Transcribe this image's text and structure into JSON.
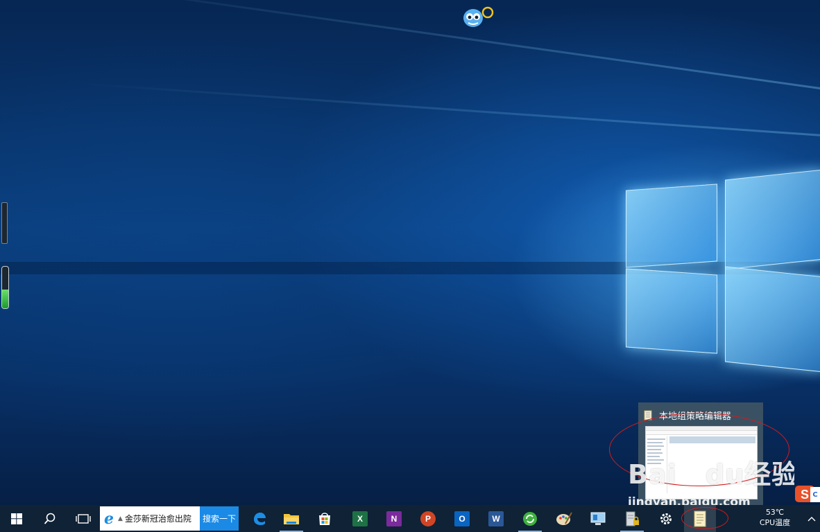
{
  "taskbar": {
    "start_icon": "windows-logo-icon",
    "search_icon": "search-icon",
    "task_view_icon": "task-view-icon",
    "browser_search": {
      "input_value": "金莎新冠治愈出院",
      "button_label": "搜索一下"
    },
    "pinned_apps": [
      {
        "name": "edge",
        "icon": "edge-icon"
      },
      {
        "name": "file-explorer",
        "icon": "folder-icon"
      },
      {
        "name": "microsoft-store",
        "icon": "store-icon"
      },
      {
        "name": "excel",
        "icon": "excel-icon",
        "letter": "X"
      },
      {
        "name": "onenote",
        "icon": "onenote-icon",
        "letter": "N"
      },
      {
        "name": "powerpoint",
        "icon": "powerpoint-icon",
        "letter": "P"
      },
      {
        "name": "outlook",
        "icon": "outlook-icon",
        "letter": "O"
      },
      {
        "name": "word",
        "icon": "word-icon",
        "letter": "W"
      },
      {
        "name": "360-browser",
        "icon": "refresh-globe-icon"
      },
      {
        "name": "paint",
        "icon": "palette-icon"
      },
      {
        "name": "remote-desktop",
        "icon": "remote-desktop-icon"
      },
      {
        "name": "server-manager",
        "icon": "server-lock-icon"
      },
      {
        "name": "settings",
        "icon": "gear-icon"
      },
      {
        "name": "local-group-policy-editor",
        "icon": "policy-document-icon"
      }
    ],
    "cpu_temp_value": "53℃",
    "cpu_temp_label": "CPU温度",
    "tray_icon": "chevron-up-icon"
  },
  "thumbnail_popup": {
    "title": "本地组策略编辑器",
    "icon": "policy-document-icon"
  },
  "watermark": {
    "logo": "Baidu经验",
    "url": "jingyan.baidu.com"
  },
  "sogou_ime": {
    "icon": "sogou-s-icon",
    "tab_letter": "C"
  },
  "side_meter_green_level": 0.45,
  "colors": {
    "taskbar_bg": "#0f2236",
    "search_button": "#1a8ae6",
    "annotation_red": "#d41b1b",
    "meter_green": "#2db24a"
  }
}
